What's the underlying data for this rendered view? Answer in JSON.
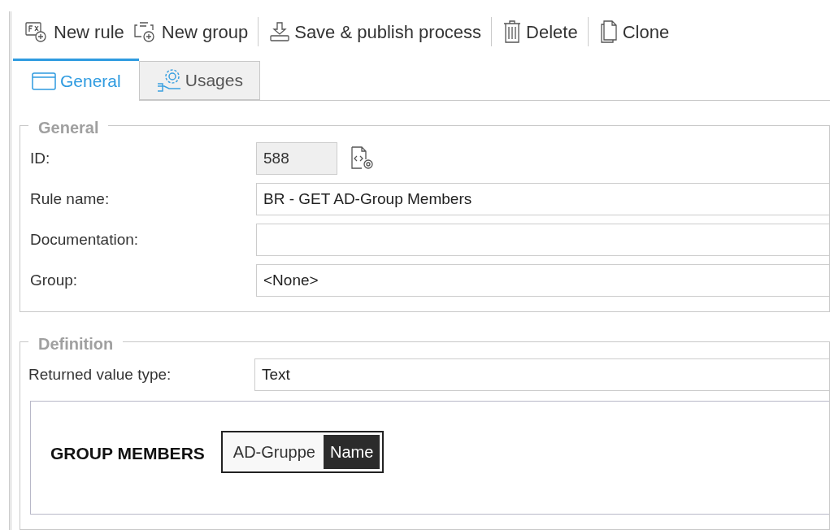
{
  "toolbar": [
    {
      "kind": "new-rule",
      "label": "New rule"
    },
    {
      "kind": "new-group",
      "label": "New group"
    },
    {
      "kind": "separator"
    },
    {
      "kind": "save",
      "label": "Save & publish process"
    },
    {
      "kind": "separator"
    },
    {
      "kind": "delete",
      "label": "Delete"
    },
    {
      "kind": "separator"
    },
    {
      "kind": "clone",
      "label": "Clone"
    }
  ],
  "tabs": [
    {
      "label": "General",
      "kind": "general",
      "selected": true
    },
    {
      "label": "Usages",
      "kind": "usages",
      "selected": false
    }
  ],
  "general": {
    "title": "General",
    "fields": [
      {
        "label": "ID:",
        "value": "588",
        "kind": "readonly"
      },
      {
        "label": "Rule name:",
        "value": "BR - GET AD-Group Members",
        "kind": "text"
      },
      {
        "label": "Documentation:",
        "kind": "text"
      },
      {
        "label": "Group:",
        "value": "<None>",
        "kind": "text"
      }
    ]
  },
  "definition": {
    "title": "Definition",
    "returned_type_label": "Returned value type:",
    "returned_type_value": "Text",
    "expression": {
      "label": "GROUP MEMBERS",
      "tokens": [
        {
          "text": "AD-Gruppe",
          "selected": false
        },
        {
          "text": "Name",
          "selected": true
        }
      ]
    }
  }
}
